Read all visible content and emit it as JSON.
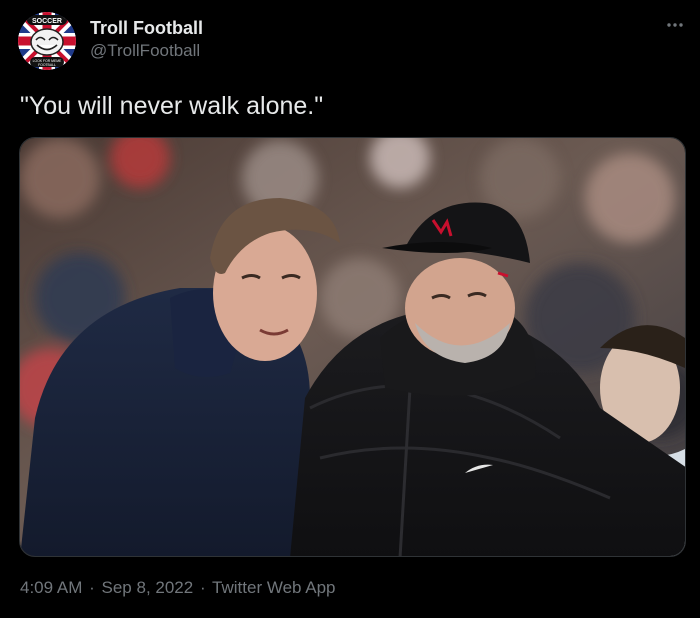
{
  "author": {
    "name": "Troll Football",
    "handle": "@TrollFootball",
    "avatar_top_text": "SOCCER",
    "avatar_bottom_text": "LOOK FOR MEME",
    "avatar_bottom_text2": "FOOTBALL"
  },
  "tweet": {
    "text": "\"You will never walk alone.\""
  },
  "meta": {
    "time": "4:09 AM",
    "separator": "·",
    "date": "Sep 8, 2022",
    "app": "Twitter Web App"
  },
  "colors": {
    "background": "#000000",
    "primary_text": "#e7e9ea",
    "secondary_text": "#71767b"
  },
  "icons": {
    "more": "more-icon"
  }
}
